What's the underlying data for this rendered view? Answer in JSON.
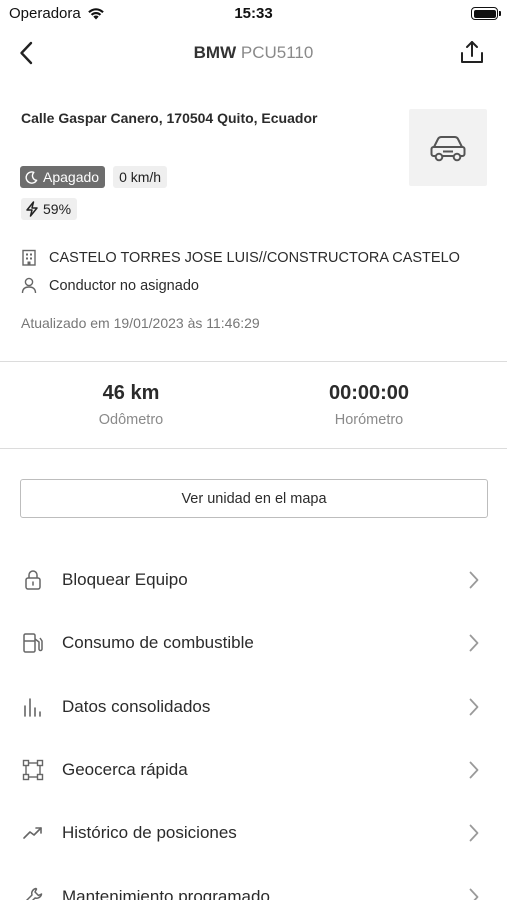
{
  "status_bar": {
    "carrier": "Operadora",
    "time": "15:33"
  },
  "nav": {
    "brand": "BMW",
    "plate": "PCU5110",
    "back_icon": "chevron-left-icon",
    "share_icon": "share-icon"
  },
  "vehicle": {
    "address": "Calle Gaspar Canero, 170504 Quito, Ecuador",
    "state": "Apagado",
    "speed": "0 km/h",
    "battery": "59%",
    "company": "CASTELO TORRES JOSE LUIS//CONSTRUCTORA CASTELO",
    "driver": "Conductor no asignado",
    "updated": "Atualizado em 19/01/2023 às 11:46:29"
  },
  "stats": {
    "odometer_value": "46 km",
    "odometer_label": "Odômetro",
    "hourmeter_value": "00:00:00",
    "hourmeter_label": "Horómetro"
  },
  "map_button": "Ver unidad en el mapa",
  "menu": [
    {
      "label": "Bloquear Equipo",
      "icon": "lock-icon"
    },
    {
      "label": "Consumo de combustible",
      "icon": "fuel-pump-icon"
    },
    {
      "label": "Datos consolidados",
      "icon": "bar-chart-icon"
    },
    {
      "label": "Geocerca rápida",
      "icon": "geofence-icon"
    },
    {
      "label": "Histórico de posiciones",
      "icon": "trend-icon"
    },
    {
      "label": "Mantenimiento programado",
      "icon": "wrench-icon"
    }
  ],
  "colors": {
    "state_badge": "#6d6d6d",
    "chip_bg": "#efefef",
    "muted_text": "#8a8a8a",
    "divider": "#dcdcdc"
  }
}
